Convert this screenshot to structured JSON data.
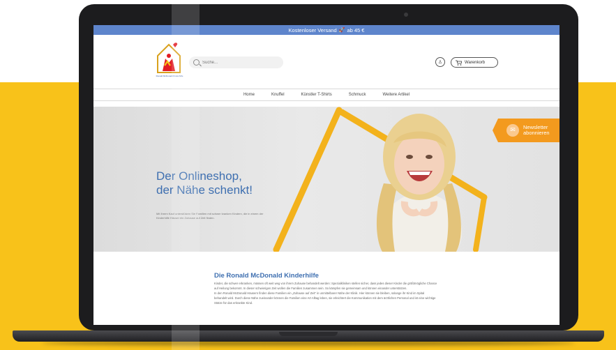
{
  "announcement": {
    "text": "Kostenloser Versand",
    "suffix": "ab 45 €",
    "icon": "rocket-icon"
  },
  "brand": {
    "caption": "Ronald McDonald Kinderhilfe"
  },
  "search": {
    "placeholder": "Suche..."
  },
  "header": {
    "cart_label": "Warenkorb"
  },
  "nav": {
    "items": [
      "Home",
      "Knuffel",
      "Künstler T-Shirts",
      "Schmuck",
      "Weitere Artikel"
    ]
  },
  "hero": {
    "title_line1": "Der Onlineshop,",
    "title_line2": "der Nähe schenkt!",
    "subtitle": "Mit Ihrem Kauf unterstützen Sie Familien mit schwer kranken Kindern, die in einem der Kinderhilfe Häuser ein Zuhause auf Zeit finden."
  },
  "newsletter": {
    "line1": "Newsletter",
    "line2": "abonnieren"
  },
  "content": {
    "title": "Die Ronald McDonald Kinderhilfe",
    "paragraph1": "Kinder, die schwer erkranken, müssen oft weit weg von ihrem Zuhause behandelt werden: Spezialkliniken stellen sicher, dass jedes dieser Kinder die größtmögliche Chance auf Heilung bekommt. In dieser schwierigen Zeit wollen die Familien zusammen sein. So kämpfen sie gemeinsam und können einander unterstützen.",
    "paragraph2": "In den Ronald McDonald Häusern finden diese Familien ein „Zuhause auf Zeit“ in unmittelbarer Nähe der Klinik. Hier können sie bleiben, solange ihr Kind im Spital behandelt wird. Durch diese Nähe zueinander können die Familien eine Art Alltag leben, sie erleichtert die Kommunikation mit dem ärztlichen Personal und ist eine wichtige Stütze für das erkrankte Kind."
  },
  "colors": {
    "accent_blue": "#5e85cc",
    "title_blue": "#3e6fb0",
    "newsletter_orange": "#f39a1e",
    "background_yellow": "#f8c21a"
  }
}
